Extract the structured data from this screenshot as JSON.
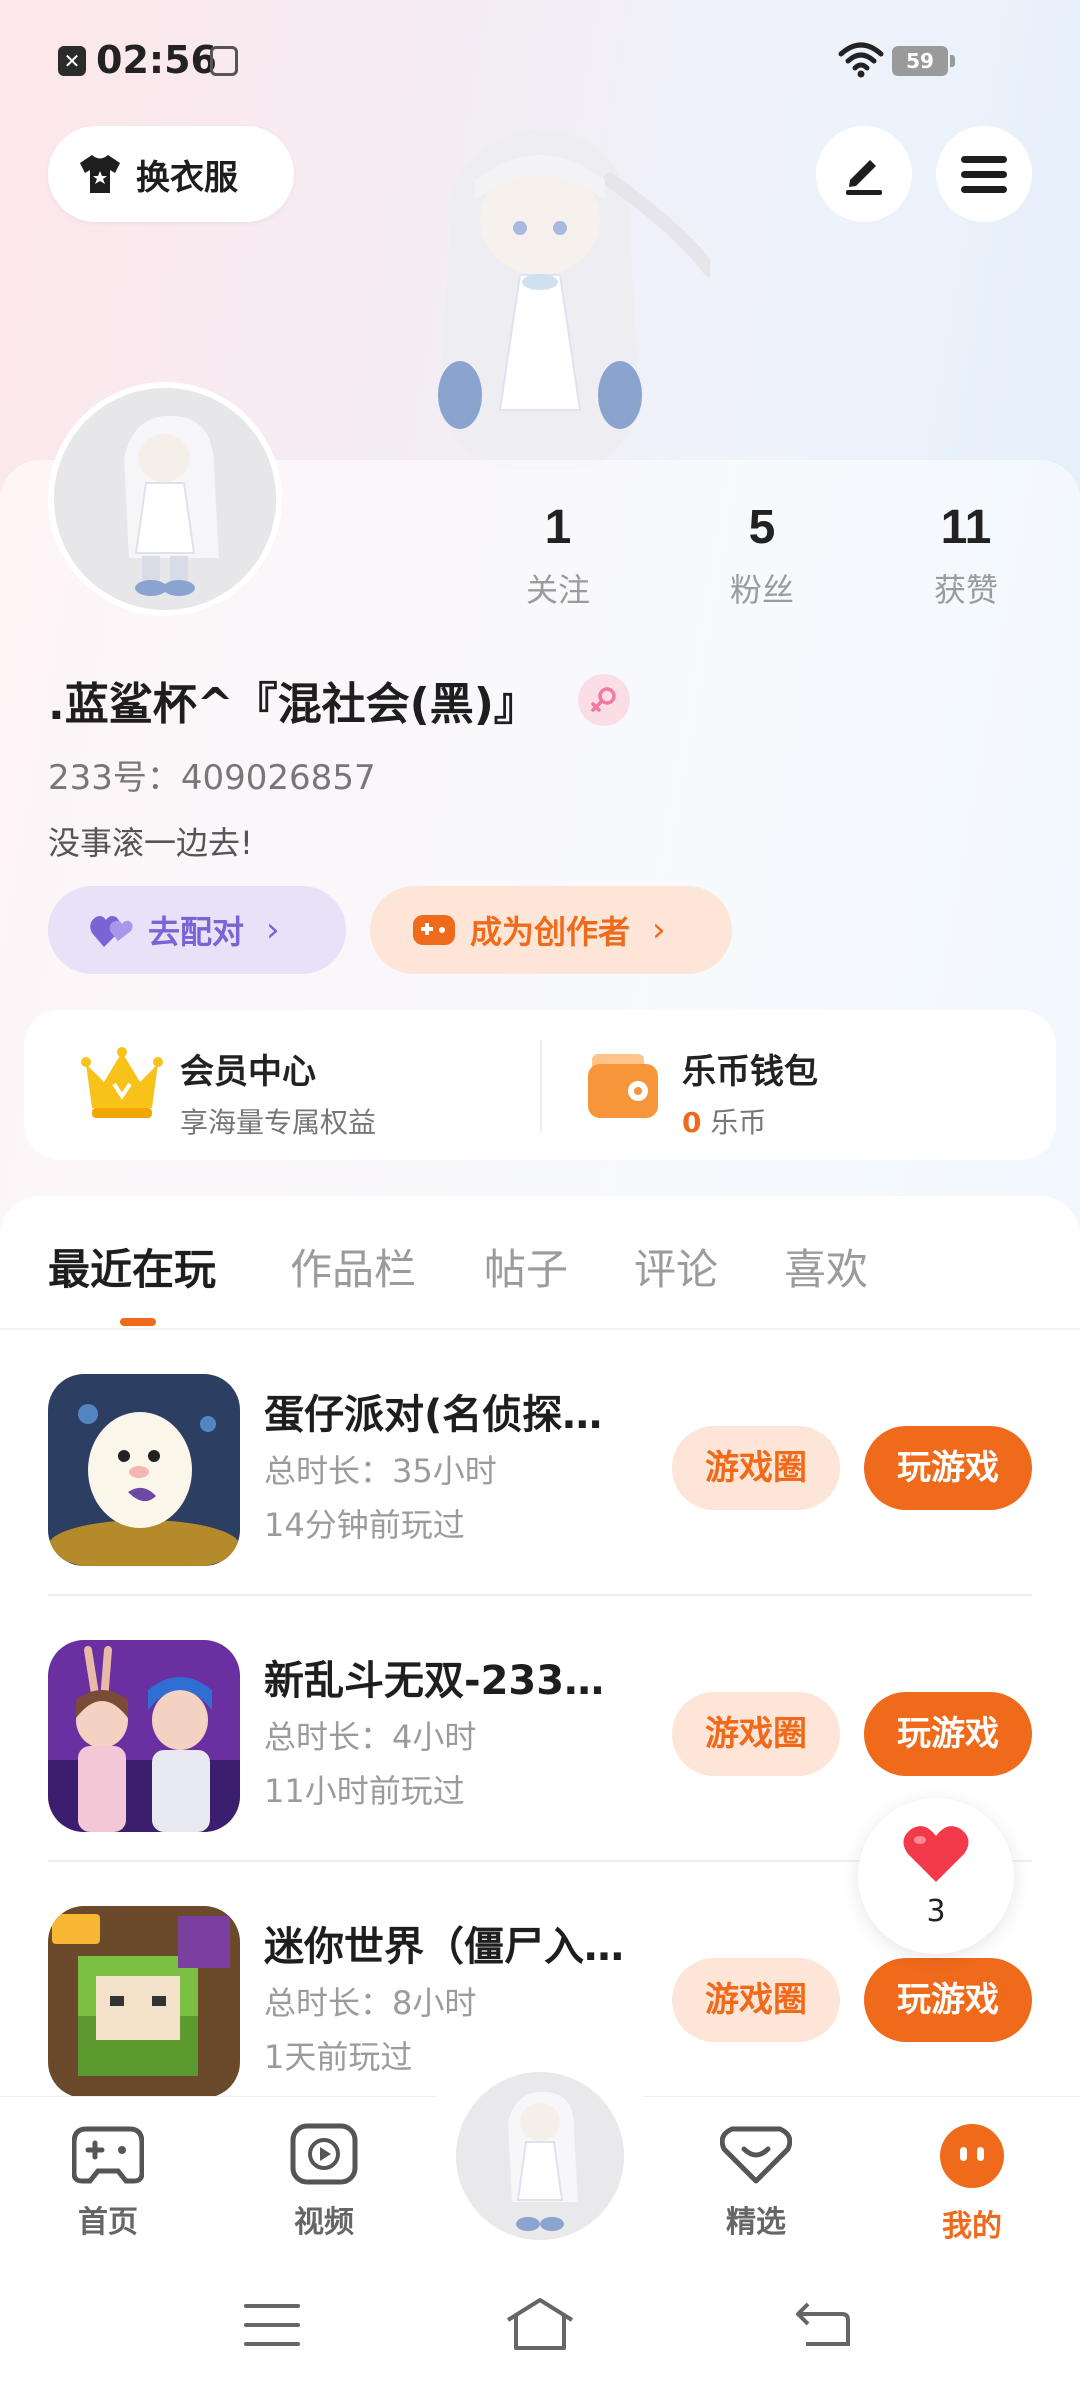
{
  "status_bar": {
    "time": "02:56",
    "battery": "59"
  },
  "header": {
    "wardrobe_label": "换衣服"
  },
  "profile": {
    "stats": [
      {
        "num": "1",
        "label": "关注"
      },
      {
        "num": "5",
        "label": "粉丝"
      },
      {
        "num": "11",
        "label": "获赞"
      }
    ],
    "username": ".蓝鲨杯^『混社会(黑)』",
    "uid": "233号：409026857",
    "bio": "没事滚一边去!"
  },
  "actions": {
    "match": "去配对",
    "creator": "成为创作者"
  },
  "member": {
    "title": "会员中心",
    "subtitle": "享海量专属权益",
    "wallet_title": "乐币钱包",
    "wallet_amount": "0",
    "wallet_unit": "乐币"
  },
  "tabs": [
    "最近在玩",
    "作品栏",
    "帖子",
    "评论",
    "喜欢"
  ],
  "games": [
    {
      "name": "蛋仔派对(名侦探…",
      "duration": "总时长：35小时",
      "last_played": "14分钟前玩过",
      "circle_btn": "游戏圈",
      "play_btn": "玩游戏"
    },
    {
      "name": "新乱斗无双-233…",
      "duration": "总时长：4小时",
      "last_played": "11小时前玩过",
      "circle_btn": "游戏圈",
      "play_btn": "玩游戏"
    },
    {
      "name": "迷你世界（僵尸入…",
      "duration": "总时长：8小时",
      "last_played": "1天前玩过",
      "circle_btn": "游戏圈",
      "play_btn": "玩游戏"
    }
  ],
  "float_like": {
    "count": "3"
  },
  "bottom_nav": [
    {
      "label": "首页",
      "icon": "gamepad-icon"
    },
    {
      "label": "视频",
      "icon": "video-icon"
    },
    {
      "label": "精选",
      "icon": "heart-diamond-icon"
    },
    {
      "label": "我的",
      "icon": "me-icon"
    }
  ],
  "colors": {
    "accent": "#f06a1c",
    "purple": "#7b63d6"
  }
}
